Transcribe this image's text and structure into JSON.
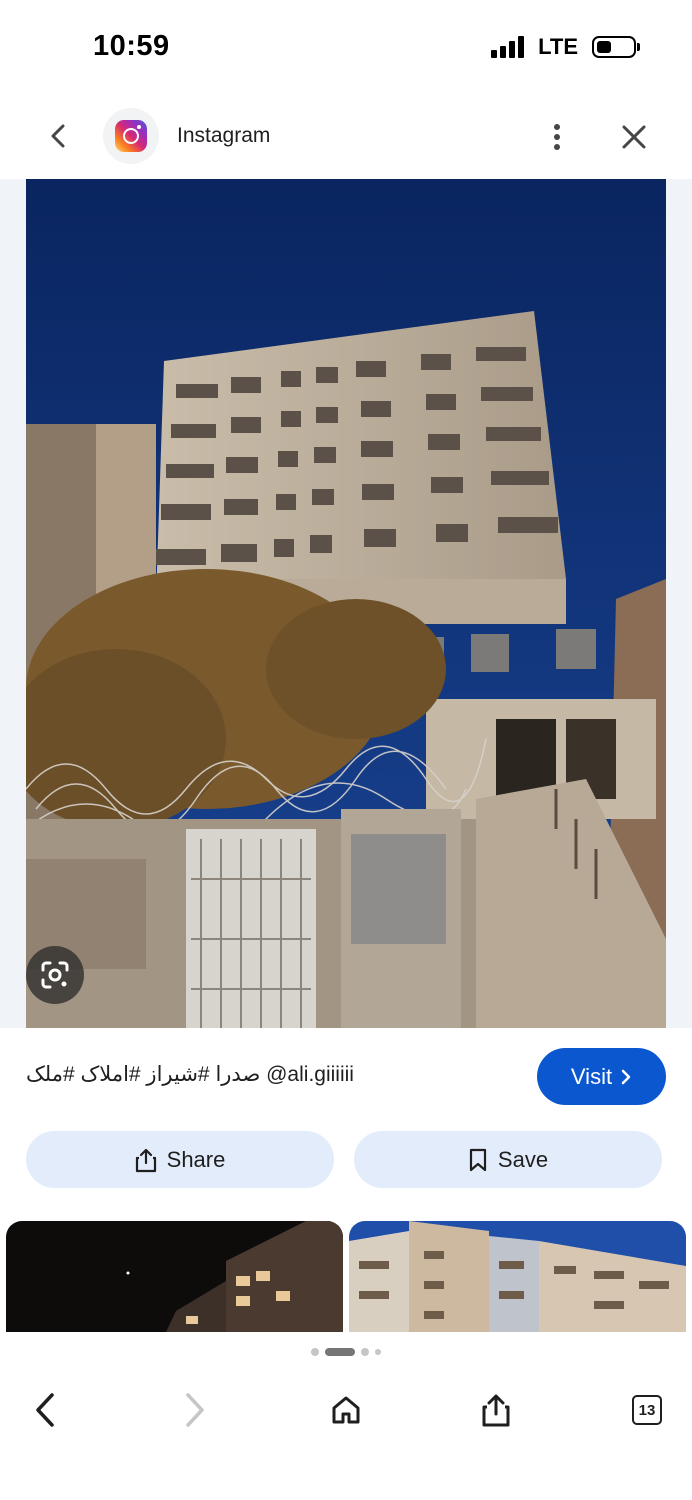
{
  "status_bar": {
    "time": "10:59",
    "network": "LTE"
  },
  "source": {
    "name": "Instagram"
  },
  "post": {
    "caption": "صدرا #شیراز #املاک #ملک @ali.giiiiii"
  },
  "buttons": {
    "visit": "Visit",
    "share": "Share",
    "save": "Save"
  },
  "toolbar": {
    "tab_count": "13"
  },
  "colors": {
    "accent": "#0b57d0",
    "chip_bg": "#e3ecfb",
    "sky": "#0d2f72"
  },
  "icons": {
    "back": "chevron-left-icon",
    "more": "more-vert-icon",
    "close": "close-icon",
    "lens": "google-lens-icon",
    "share": "share-icon",
    "save": "bookmark-icon",
    "home": "home-icon",
    "tabs": "tabs-icon"
  }
}
